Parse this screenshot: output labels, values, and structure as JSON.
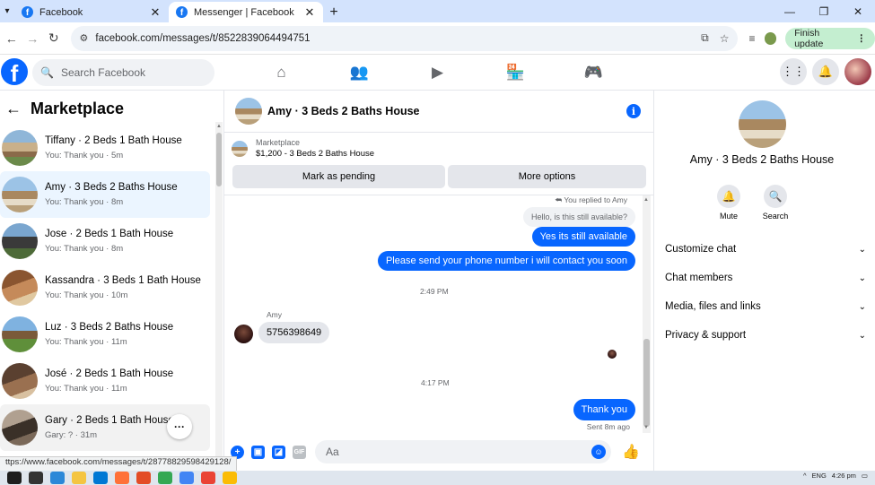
{
  "browser": {
    "tabs": [
      {
        "title": "Facebook",
        "active": false
      },
      {
        "title": "Messenger | Facebook",
        "active": true
      }
    ],
    "url": "facebook.com/messages/t/8522839064494751",
    "finish_update": "Finish update",
    "status_url": "ttps://www.facebook.com/messages/t/28778829598429128/"
  },
  "header": {
    "search_placeholder": "Search Facebook"
  },
  "sidebar": {
    "title": "Marketplace",
    "conversations": [
      {
        "name": "Tiffany · 2 Beds 1 Bath House",
        "preview": "You: Thank you · 5m"
      },
      {
        "name": "Amy · 3 Beds 2 Baths House",
        "preview": "You: Thank you · 8m"
      },
      {
        "name": "Jose · 2 Beds 1 Bath House",
        "preview": "You: Thank you · 8m"
      },
      {
        "name": "Kassandra · 3 Beds 1 Bath House",
        "preview": "You: Thank you · 10m"
      },
      {
        "name": "Luz · 3 Beds 2 Baths House",
        "preview": "You: Thank you · 11m"
      },
      {
        "name": "José · 2 Beds 1 Bath House",
        "preview": "You: Thank you · 11m"
      },
      {
        "name": "Gary · 2 Beds 1 Bath House",
        "preview": "Gary: ? · 31m"
      }
    ]
  },
  "chat": {
    "title": "Amy · 3 Beds 2 Baths House",
    "marketplace_label": "Marketplace",
    "listing": "$1,200 - 3 Beds 2 Baths House",
    "mark_pending": "Mark as pending",
    "more_options": "More options",
    "replied_to": "You replied to Amy",
    "messages": {
      "quoted": "Hello, is this still available?",
      "m1": "Yes its still available",
      "m2": "Please send your phone number i will contact you soon",
      "time1": "2:49 PM",
      "sender": "Amy",
      "m3": "5756398649",
      "time2": "4:17 PM",
      "m4": "Thank you",
      "sent": "Sent 8m ago"
    },
    "composer_placeholder": "Aa"
  },
  "details": {
    "name": "Amy · 3 Beds 2 Baths House",
    "mute": "Mute",
    "search": "Search",
    "menu": [
      "Customize chat",
      "Chat members",
      "Media, files and links",
      "Privacy & support"
    ]
  },
  "taskbar": {
    "time": "4:26 pm",
    "lang": "ENG"
  }
}
